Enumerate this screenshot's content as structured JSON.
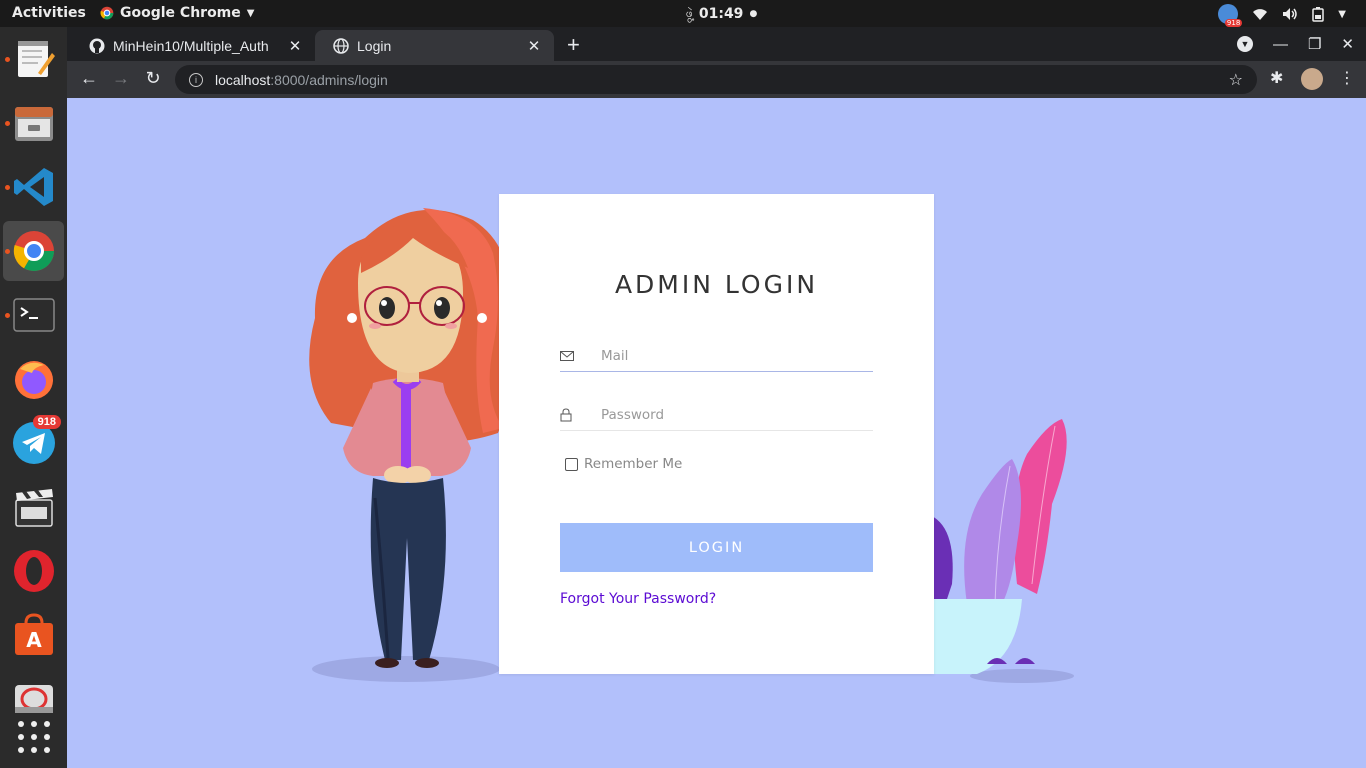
{
  "system": {
    "activities": "Activities",
    "app_name": "Google Chrome",
    "clock": "01:49",
    "input_method": "ဖွဲ့",
    "tray_badge": "918"
  },
  "dock": {
    "items": [
      "text-editor",
      "files",
      "vscode",
      "chrome",
      "terminal",
      "firefox",
      "telegram",
      "video-editor",
      "opera",
      "software-center",
      "screenshot"
    ],
    "telegram_badge": "918"
  },
  "browser": {
    "tabs": [
      {
        "title": "MinHein10/Multiple_Auth",
        "active": false
      },
      {
        "title": "Login",
        "active": true
      }
    ],
    "url_host": "localhost",
    "url_path": ":8000/admins/login"
  },
  "page": {
    "heading": "ADMIN LOGIN",
    "mail_placeholder": "Mail",
    "password_placeholder": "Password",
    "remember_label": "Remember Me",
    "login_button": "LOGIN",
    "forgot_link": "Forgot Your Password?"
  },
  "colors": {
    "page_bg": "#b2c0fb",
    "button_bg": "#9fbcfa",
    "link": "#5b0ad3"
  }
}
